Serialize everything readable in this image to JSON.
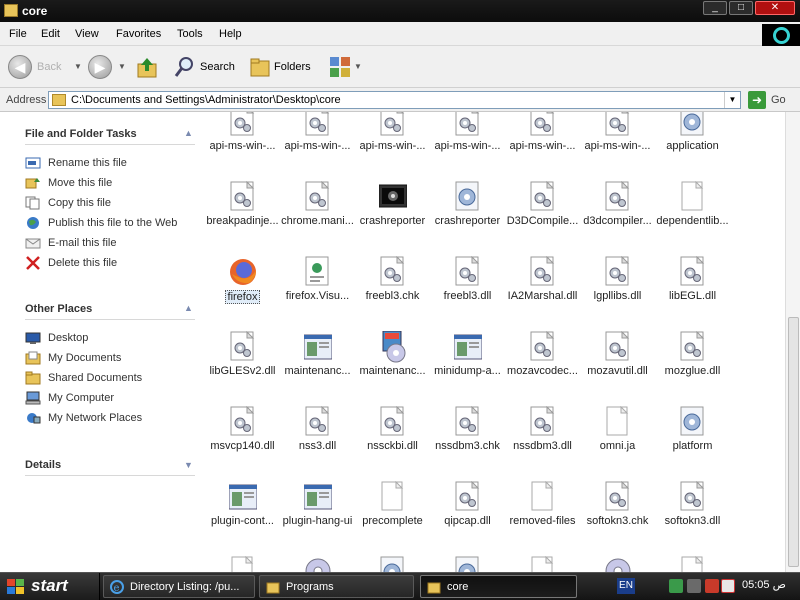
{
  "window": {
    "title": "core",
    "minimize_glyph": "_",
    "maximize_glyph": "□",
    "close_glyph": "✕"
  },
  "menu": [
    "File",
    "Edit",
    "View",
    "Favorites",
    "Tools",
    "Help"
  ],
  "toolbar": {
    "back_label": "Back",
    "search_label": "Search",
    "folders_label": "Folders"
  },
  "address": {
    "label": "Address",
    "value": "C:\\Documents and Settings\\Administrator\\Desktop\\core",
    "go_label": "Go"
  },
  "left_pane": {
    "file_tasks": {
      "title": "File and Folder Tasks",
      "items": [
        {
          "label": "Rename this file",
          "icon": "rename-icon"
        },
        {
          "label": "Move this file",
          "icon": "move-icon"
        },
        {
          "label": "Copy this file",
          "icon": "copy-icon"
        },
        {
          "label": "Publish this file to the Web",
          "icon": "publish-web-icon"
        },
        {
          "label": "E-mail this file",
          "icon": "email-icon"
        },
        {
          "label": "Delete this file",
          "icon": "delete-icon"
        }
      ]
    },
    "other_places": {
      "title": "Other Places",
      "items": [
        {
          "label": "Desktop",
          "icon": "desktop-icon"
        },
        {
          "label": "My Documents",
          "icon": "my-documents-icon"
        },
        {
          "label": "Shared Documents",
          "icon": "shared-documents-icon"
        },
        {
          "label": "My Computer",
          "icon": "my-computer-icon"
        },
        {
          "label": "My Network Places",
          "icon": "network-places-icon"
        }
      ]
    },
    "details": {
      "title": "Details"
    }
  },
  "files": [
    {
      "name": "api-ms-win-...",
      "icon": "dll"
    },
    {
      "name": "api-ms-win-...",
      "icon": "dll"
    },
    {
      "name": "api-ms-win-...",
      "icon": "dll"
    },
    {
      "name": "api-ms-win-...",
      "icon": "dll"
    },
    {
      "name": "api-ms-win-...",
      "icon": "dll"
    },
    {
      "name": "api-ms-win-...",
      "icon": "dll"
    },
    {
      "name": "application",
      "icon": "ini"
    },
    {
      "name": "breakpadinje...",
      "icon": "dll"
    },
    {
      "name": "chrome.mani...",
      "icon": "dll"
    },
    {
      "name": "crashreporter",
      "icon": "exe-dark"
    },
    {
      "name": "crashreporter",
      "icon": "ini"
    },
    {
      "name": "D3DCompile...",
      "icon": "dll"
    },
    {
      "name": "d3dcompiler...",
      "icon": "dll"
    },
    {
      "name": "dependentlib...",
      "icon": "blank"
    },
    {
      "name": "firefox",
      "icon": "firefox",
      "selected": true
    },
    {
      "name": "firefox.Visu...",
      "icon": "manifest"
    },
    {
      "name": "freebl3.chk",
      "icon": "dll"
    },
    {
      "name": "freebl3.dll",
      "icon": "dll"
    },
    {
      "name": "IA2Marshal.dll",
      "icon": "dll"
    },
    {
      "name": "lgpllibs.dll",
      "icon": "dll"
    },
    {
      "name": "libEGL.dll",
      "icon": "dll"
    },
    {
      "name": "libGLESv2.dll",
      "icon": "dll"
    },
    {
      "name": "maintenanc...",
      "icon": "window"
    },
    {
      "name": "maintenanc...",
      "icon": "installer"
    },
    {
      "name": "minidump-a...",
      "icon": "window"
    },
    {
      "name": "mozavcodec...",
      "icon": "dll"
    },
    {
      "name": "mozavutil.dll",
      "icon": "dll"
    },
    {
      "name": "mozglue.dll",
      "icon": "dll"
    },
    {
      "name": "msvcp140.dll",
      "icon": "dll"
    },
    {
      "name": "nss3.dll",
      "icon": "dll"
    },
    {
      "name": "nssckbi.dll",
      "icon": "dll"
    },
    {
      "name": "nssdbm3.chk",
      "icon": "dll"
    },
    {
      "name": "nssdbm3.dll",
      "icon": "dll"
    },
    {
      "name": "omni.ja",
      "icon": "blank"
    },
    {
      "name": "platform",
      "icon": "ini"
    },
    {
      "name": "plugin-cont...",
      "icon": "window"
    },
    {
      "name": "plugin-hang-ui",
      "icon": "window"
    },
    {
      "name": "precomplete",
      "icon": "blank"
    },
    {
      "name": "qipcap.dll",
      "icon": "dll"
    },
    {
      "name": "removed-files",
      "icon": "blank"
    },
    {
      "name": "softokn3.chk",
      "icon": "dll"
    },
    {
      "name": "softokn3.dll",
      "icon": "dll"
    },
    {
      "name": "",
      "icon": "blank"
    },
    {
      "name": "",
      "icon": "disc"
    },
    {
      "name": "",
      "icon": "ini"
    },
    {
      "name": "",
      "icon": "ini"
    },
    {
      "name": "",
      "icon": "blank"
    },
    {
      "name": "",
      "icon": "disc"
    },
    {
      "name": "",
      "icon": "blank"
    }
  ],
  "taskbar": {
    "start_label": "start",
    "tasks": [
      {
        "label": "Directory Listing: /pu...",
        "icon": "ie-icon"
      },
      {
        "label": "Programs",
        "icon": "folder-icon"
      },
      {
        "label": "core",
        "icon": "folder-icon",
        "active": true
      }
    ],
    "language": "EN",
    "clock": "05:05 ص"
  }
}
